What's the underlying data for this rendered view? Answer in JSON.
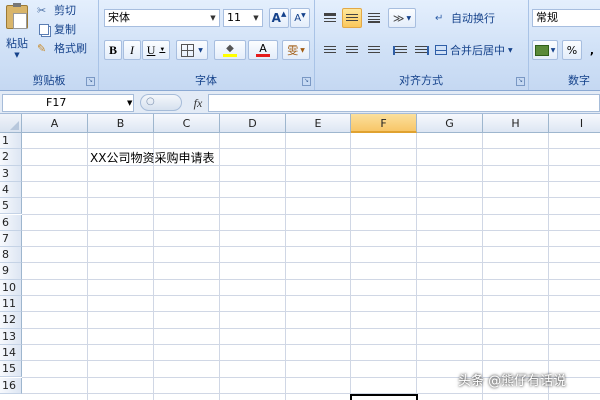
{
  "clipboard": {
    "paste": "粘贴",
    "cut": "剪切",
    "copy": "复制",
    "format_painter": "格式刷",
    "label": "剪贴板"
  },
  "font": {
    "name": "宋体",
    "size": "11",
    "grow": "A",
    "shrink": "A",
    "bold": "B",
    "italic": "I",
    "underline": "U",
    "font_color_glyph": "A",
    "phonetic": "雯",
    "label": "字体"
  },
  "alignment": {
    "wrap_text": "自动换行",
    "merge_center": "合并后居中",
    "label": "对齐方式"
  },
  "number": {
    "format": "常规",
    "percent": "%",
    "label": "数字"
  },
  "formula_bar": {
    "name_box": "F17",
    "fx": "fx"
  },
  "sheet": {
    "columns": [
      "A",
      "B",
      "C",
      "D",
      "E",
      "F",
      "G",
      "H",
      "I"
    ],
    "rows": [
      "1",
      "2",
      "3",
      "4",
      "5",
      "6",
      "7",
      "8",
      "9",
      "10",
      "11",
      "12",
      "13",
      "14",
      "15",
      "16"
    ],
    "cell_b2": "XX公司物资采购申请表",
    "selected_column": "F",
    "active_cell": "F17"
  },
  "watermark": "头条 @熊仔有话说",
  "colors": {
    "ribbon_bg": "#cfe0f6",
    "accent_selected": "#f8c668",
    "grid_line": "#d0d7e5",
    "font_color_bar": "#e51c1c",
    "highlight_bar": "#ffff00"
  }
}
